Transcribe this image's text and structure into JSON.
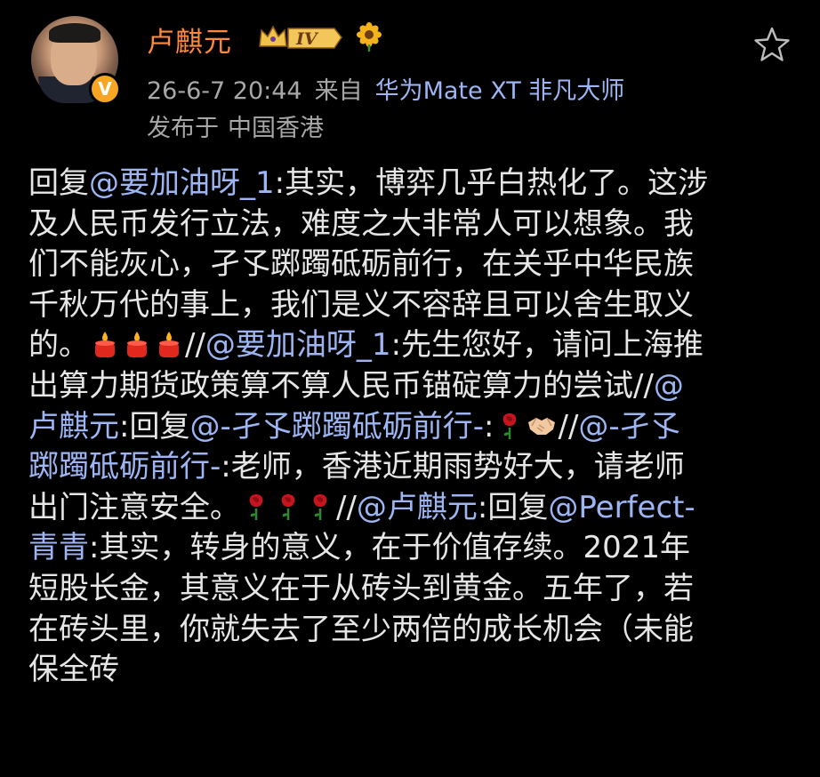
{
  "post": {
    "author": {
      "name": "卢麒元",
      "level": "IV",
      "verified_icon": "v-badge-icon",
      "colors": {
        "name": "#ff8a3d",
        "badge": "#f6a623",
        "mention": "#9db6f3"
      }
    },
    "meta": {
      "timestamp": "26-6-7 20:44",
      "source_prefix": "来自",
      "device": "华为Mate XT 非凡大师",
      "location_prefix": "发布于",
      "location": "中国香港"
    },
    "content": {
      "l1": {
        "a": "回复",
        "b": "@要加油呀_1",
        "c": ":其实，博弈几乎白热化了。这涉"
      },
      "l2": "及人民币发行立法，难度之大非常人可以想象。我",
      "l3": "们不能灰心，孑孓踯躅砥砺前行，在关乎中华民族",
      "l4": "千秋万代的事上，我们是义不容辞且可以舍生取义",
      "l5": {
        "a": "的。",
        "b": "//",
        "c": "@要加油呀_1",
        "d": ":先生您好，请问上海推"
      },
      "l6": {
        "a": "出算力期货政策算不算人民币锚碇算力的尝试//",
        "b": "@"
      },
      "l7": {
        "a": "卢麒元",
        "b": ":回复",
        "c": "@-孑孓踯躅砥砺前行-",
        "d": ":",
        "e": "//",
        "f": "@-孑孓"
      },
      "l8": {
        "a": "踯躅砥砺前行-",
        "b": ":老师，香港近期雨势好大，请老师"
      },
      "l9": {
        "a": "出门注意安全。",
        "b": "//",
        "c": "@卢麒元",
        "d": ":回复",
        "e": "@Perfect-"
      },
      "l10": {
        "a": "青青",
        "b": ":其实，转身的意义，在于价值存续。2021年"
      },
      "l11": "短股长金，其意义在于从砖头到黄金。五年了，若",
      "l12": "在砖头里，你就失去了至少两倍的成长机会（未能",
      "l13": "保全砖"
    }
  }
}
